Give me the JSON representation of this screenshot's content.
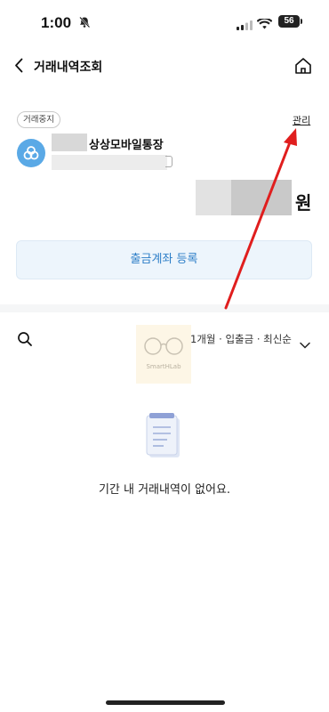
{
  "status_bar": {
    "time": "1:00",
    "battery": "56"
  },
  "nav": {
    "title": "거래내역조회"
  },
  "account": {
    "badge": "거래중지",
    "manage_label": "관리",
    "name": "상상모바일통장",
    "currency_unit": "원"
  },
  "register_button": {
    "label": "출금계좌 등록"
  },
  "filter": {
    "label": "1개월 · 입출금 · 최신순"
  },
  "watermark": {
    "text": "SmartHLab"
  },
  "empty_state": {
    "message": "기간 내 거래내역이 없어요."
  },
  "colors": {
    "accent": "#2e7fc8",
    "arrow": "#e01e1e",
    "button_bg": "#edf5fc"
  }
}
